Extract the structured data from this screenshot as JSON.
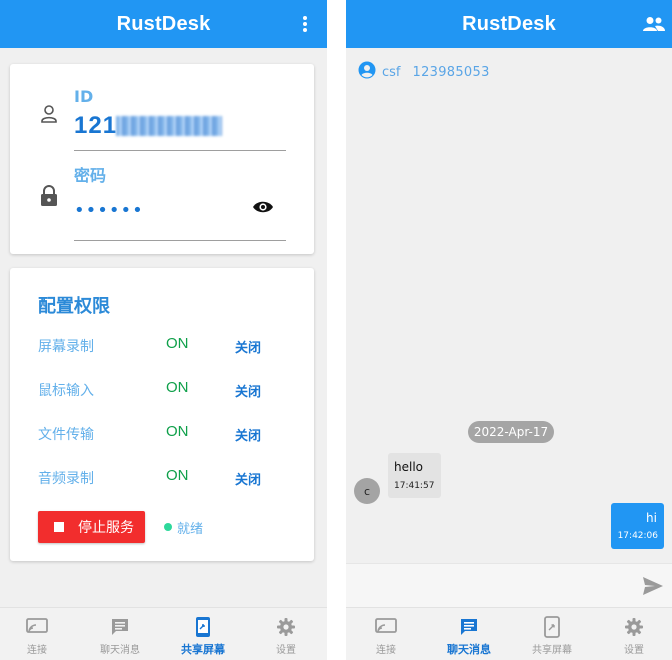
{
  "left": {
    "app_title": "RustDesk",
    "id_label": "ID",
    "id_value_visible": "121",
    "password_label": "密码",
    "password_masked": "••••••",
    "permissions_title": "配置权限",
    "permissions": [
      {
        "name": "屏幕录制",
        "state": "ON",
        "action": "关闭"
      },
      {
        "name": "鼠标输入",
        "state": "ON",
        "action": "关闭"
      },
      {
        "name": "文件传输",
        "state": "ON",
        "action": "关闭"
      },
      {
        "name": "音频录制",
        "state": "ON",
        "action": "关闭"
      }
    ],
    "stop_button": "停止服务",
    "status": "就绪",
    "nav": [
      {
        "label": "连接",
        "icon": "screen-share-icon"
      },
      {
        "label": "聊天消息",
        "icon": "chat-icon"
      },
      {
        "label": "共享屏幕",
        "icon": "mobile-screen-share-icon",
        "active": true
      },
      {
        "label": "设置",
        "icon": "gear-icon"
      }
    ]
  },
  "right": {
    "app_title": "RustDesk",
    "peer_name": "csf",
    "peer_id": "123985053",
    "date_chip": "2022-Apr-17",
    "avatar_letter": "c",
    "messages": [
      {
        "from": "peer",
        "text": "hello",
        "time": "17:41:57"
      },
      {
        "from": "me",
        "text": "hi",
        "time": "17:42:06"
      }
    ],
    "input_placeholder": "",
    "nav": [
      {
        "label": "连接",
        "icon": "screen-share-icon"
      },
      {
        "label": "聊天消息",
        "icon": "chat-icon",
        "active": true
      },
      {
        "label": "共享屏幕",
        "icon": "mobile-screen-share-icon"
      },
      {
        "label": "设置",
        "icon": "gear-icon"
      }
    ]
  },
  "colors": {
    "primary": "#2196f3",
    "stop": "#f22d2d",
    "on": "#0fa04a",
    "ready": "#2ed89b"
  }
}
